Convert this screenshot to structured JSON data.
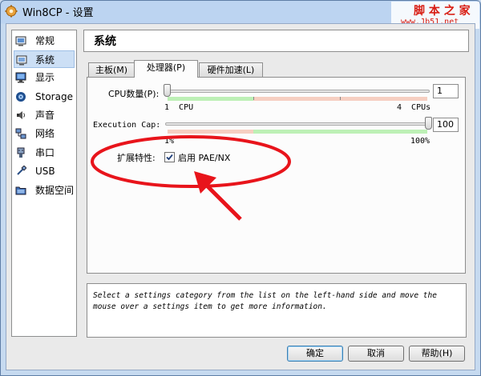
{
  "window": {
    "title": "Win8CP - 设置"
  },
  "watermark": {
    "line1": "脚 本 之 家",
    "line2": "www.Jb51.net"
  },
  "sidebar": {
    "items": [
      {
        "label": "常规",
        "icon": "general-icon"
      },
      {
        "label": "系统",
        "icon": "system-icon",
        "selected": true
      },
      {
        "label": "显示",
        "icon": "display-icon"
      },
      {
        "label": "Storage",
        "icon": "storage-icon"
      },
      {
        "label": "声音",
        "icon": "audio-icon"
      },
      {
        "label": "网络",
        "icon": "network-icon"
      },
      {
        "label": "串口",
        "icon": "serial-port-icon"
      },
      {
        "label": "USB",
        "icon": "usb-icon"
      },
      {
        "label": "数据空间",
        "icon": "shared-folder-icon"
      }
    ]
  },
  "page": {
    "title": "系统"
  },
  "tabs": [
    {
      "label": "主板(M)"
    },
    {
      "label": "处理器(P)",
      "active": true
    },
    {
      "label": "硬件加速(L)"
    }
  ],
  "processor": {
    "cpu_label": "CPU数量(P):",
    "cpu_value": "1",
    "cpu_min_label": "1  CPU",
    "cpu_max_label": "4  CPUs",
    "cpu_fraction": 0.0,
    "cap_label": "Execution Cap:",
    "cap_value": "100",
    "cap_min_label": "1%",
    "cap_max_label": "100%",
    "cap_fraction": 1.0,
    "ext_label": "扩展特性:",
    "pae_label": "启用 PAE/NX",
    "pae_checked": true
  },
  "info": {
    "text": "Select a settings category from the list on the left-hand side and move the mouse over a settings item to get more information."
  },
  "buttons": {
    "ok": "确定",
    "cancel": "取消",
    "help": "帮助(H)"
  },
  "colors": {
    "annotation": "#e8141b",
    "green_zone": "#bdf0b6",
    "red_zone": "#f6cfc2"
  }
}
